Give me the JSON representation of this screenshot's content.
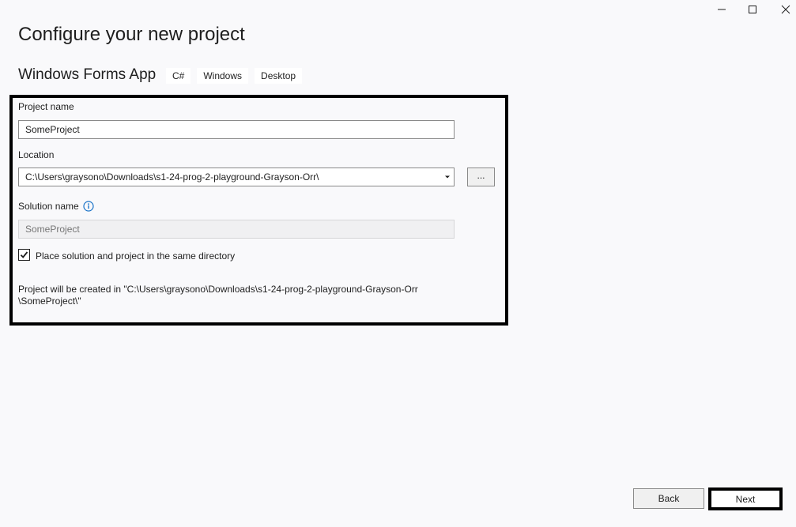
{
  "window_controls": {
    "minimize_icon": "minimize-icon",
    "maximize_icon": "maximize-icon",
    "close_icon": "close-icon"
  },
  "page": {
    "title": "Configure your new project",
    "template_name": "Windows Forms App",
    "tags": [
      "C#",
      "Windows",
      "Desktop"
    ]
  },
  "form": {
    "project_name_label": "Project name",
    "project_name_value": "SomeProject",
    "location_label": "Location",
    "location_value": "C:\\Users\\graysono\\Downloads\\s1-24-prog-2-playground-Grayson-Orr\\",
    "browse_label": "...",
    "solution_name_label": "Solution name",
    "solution_name_placeholder": "SomeProject",
    "info_icon": "info-icon",
    "same_directory_label": "Place solution and project in the same directory",
    "same_directory_checked": true,
    "created_info_line1": "Project will be created in \"C:\\Users\\graysono\\Downloads\\s1-24-prog-2-playground-Grayson-Orr",
    "created_info_line2": "\\SomeProject\\\""
  },
  "footer": {
    "back_label": "Back",
    "next_label": "Next"
  },
  "colors": {
    "background": "#f9f9fb",
    "info_blue": "#1a73c8",
    "highlight_border": "#000000"
  }
}
